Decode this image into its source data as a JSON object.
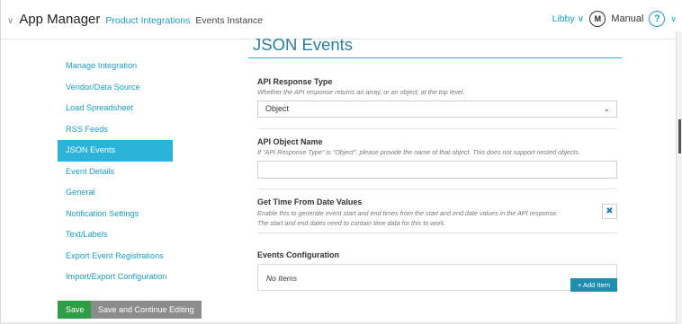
{
  "header": {
    "app_title": "App Manager",
    "breadcrumb_link": "Product Integrations",
    "breadcrumb_current": "Events Instance",
    "user_name": "Libby",
    "manual_label": "Manual",
    "help_glyph": "?"
  },
  "sidebar": {
    "items": [
      {
        "label": "Manage Integration"
      },
      {
        "label": "Vendor/Data Source"
      },
      {
        "label": "Load Spreadsheet"
      },
      {
        "label": "RSS Feeds"
      },
      {
        "label": "JSON Events",
        "active": true
      },
      {
        "label": "Event Details"
      },
      {
        "label": "General"
      },
      {
        "label": "Notification Settings"
      },
      {
        "label": "Text/Labels"
      },
      {
        "label": "Export Event Registrations"
      },
      {
        "label": "Import/Export Configuration"
      }
    ],
    "save_label": "Save",
    "save_continue_label": "Save and Continue Editing"
  },
  "main": {
    "title": "JSON Events",
    "response_type": {
      "label": "API Response Type",
      "help": "Whether the API response returns an array, or an object, at the top level.",
      "selected": "Object"
    },
    "object_name": {
      "label": "API Object Name",
      "help": "If \"API Response Type\" is \"Object\", please provide the name of that object. This does not support nested objects.",
      "value": ""
    },
    "time_from_date": {
      "label": "Get Time From Date Values",
      "help_line1": "Enable this to generate event start and end times from the start and end date values in the API response.",
      "help_line2": "The start and end dates need to contain time data for this to work.",
      "toggle_glyph": "✖"
    },
    "events_config": {
      "label": "Events Configuration",
      "empty_text": "No Items",
      "add_label": "+ Add Item"
    }
  },
  "colors": {
    "accent": "#1aa0c4",
    "active_bg": "#2cb3dc",
    "title": "#2a7fa3",
    "save": "#2e9e46",
    "save_continue": "#8c8c8c"
  }
}
